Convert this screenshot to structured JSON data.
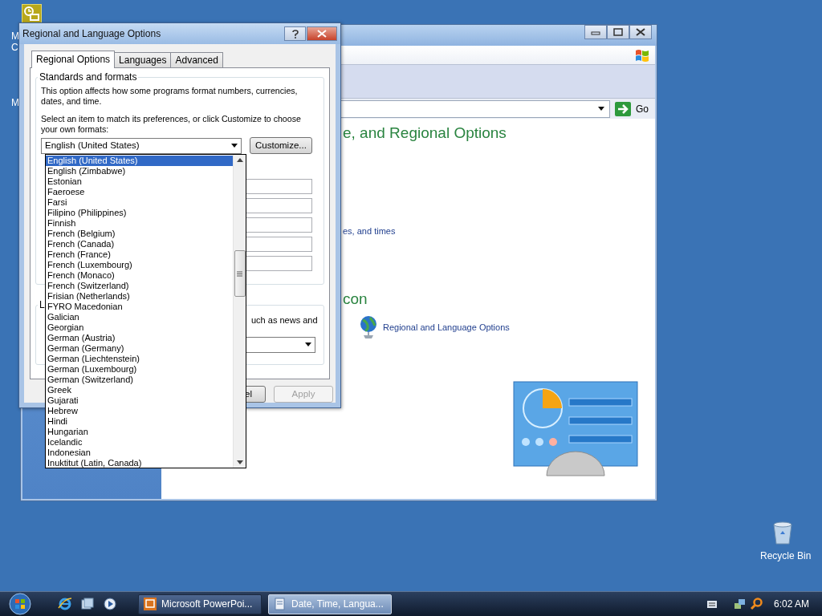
{
  "desktop": {
    "partial_labels": [
      "M",
      "C",
      "M"
    ],
    "recycle_bin": "Recycle Bin"
  },
  "background_window": {
    "go_button": "Go",
    "heading": "e, and Regional Options",
    "link": "es, and times",
    "heading_2": "con",
    "task_link": "Regional and Language Options"
  },
  "dialog": {
    "title": "Regional and Language Options",
    "tabs": [
      {
        "label": "Regional Options",
        "selected": true
      },
      {
        "label": "Languages",
        "selected": false
      },
      {
        "label": "Advanced",
        "selected": false
      }
    ],
    "group_title": "Standards and formats",
    "description": "This option affects how some programs format numbers, currencies, dates, and time.",
    "instruction": "Select an item to match its preferences, or click Customize to choose your own formats:",
    "format_select": "English (United States)",
    "customize_button": "Customize...",
    "location_group_title": "L",
    "location_text": "uch as news and",
    "cancel_button": "el",
    "apply_button": {
      "label": "Apply",
      "disabled": true
    }
  },
  "dropdown": {
    "items": [
      {
        "label": "English (United States)",
        "selected": true
      },
      {
        "label": "English (Zimbabwe)",
        "selected": false
      },
      {
        "label": "Estonian",
        "selected": false
      },
      {
        "label": "Faeroese",
        "selected": false
      },
      {
        "label": "Farsi",
        "selected": false
      },
      {
        "label": "Filipino (Philippines)",
        "selected": false
      },
      {
        "label": "Finnish",
        "selected": false
      },
      {
        "label": "French (Belgium)",
        "selected": false
      },
      {
        "label": "French (Canada)",
        "selected": false
      },
      {
        "label": "French (France)",
        "selected": false
      },
      {
        "label": "French (Luxembourg)",
        "selected": false
      },
      {
        "label": "French (Monaco)",
        "selected": false
      },
      {
        "label": "French (Switzerland)",
        "selected": false
      },
      {
        "label": "Frisian (Netherlands)",
        "selected": false
      },
      {
        "label": "FYRO Macedonian",
        "selected": false
      },
      {
        "label": "Galician",
        "selected": false
      },
      {
        "label": "Georgian",
        "selected": false
      },
      {
        "label": "German (Austria)",
        "selected": false
      },
      {
        "label": "German (Germany)",
        "selected": false
      },
      {
        "label": "German (Liechtenstein)",
        "selected": false
      },
      {
        "label": "German (Luxembourg)",
        "selected": false
      },
      {
        "label": "German (Switzerland)",
        "selected": false
      },
      {
        "label": "Greek",
        "selected": false
      },
      {
        "label": "Gujarati",
        "selected": false
      },
      {
        "label": "Hebrew",
        "selected": false
      },
      {
        "label": "Hindi",
        "selected": false
      },
      {
        "label": "Hungarian",
        "selected": false
      },
      {
        "label": "Icelandic",
        "selected": false
      },
      {
        "label": "Indonesian",
        "selected": false
      },
      {
        "label": "Inuktitut (Latin, Canada)",
        "selected": false
      }
    ]
  },
  "taskbar": {
    "tasks": [
      {
        "label": "Microsoft PowerPoi...",
        "active": false
      },
      {
        "label": "Date, Time, Langua...",
        "active": true
      }
    ],
    "clock": "6:02 AM"
  }
}
